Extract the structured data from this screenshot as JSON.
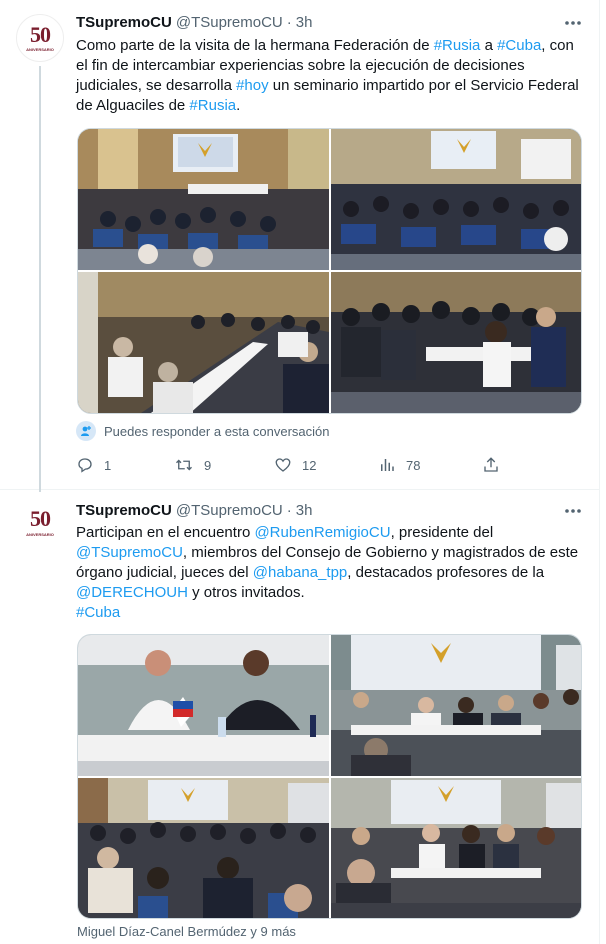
{
  "tweets": [
    {
      "name": "TSupremoCU",
      "handle": "@TSupremoCU",
      "separator": "·",
      "time": "3h",
      "avatar_number": "50",
      "avatar_caption": "ANIVERSARIO",
      "text_parts": {
        "p1": "Como parte de la visita de la hermana Federación de ",
        "l1": "#Rusia",
        "p2": " a ",
        "l2": "#Cuba",
        "p3": ", con el fin de intercambiar experiencias sobre la ejecución de decisiones judiciales, se desarrolla ",
        "l3": "#hoy",
        "p4": " un seminario impartido por el Servicio Federal de Alguaciles de ",
        "l4": "#Rusia",
        "p5": "."
      },
      "reply_notice": "Puedes responder a esta conversación",
      "counts": {
        "replies": "1",
        "retweets": "9",
        "likes": "12",
        "views": "78"
      }
    },
    {
      "name": "TSupremoCU",
      "handle": "@TSupremoCU",
      "separator": "·",
      "time": "3h",
      "avatar_number": "50",
      "avatar_caption": "ANIVERSARIO",
      "text_parts": {
        "p1": "Participan en el encuentro ",
        "l1": "@RubenRemigioCU",
        "p2": ", presidente del ",
        "l2": "@TSupremoCU",
        "p3": ", miembros del Consejo de Gobierno y magistrados de este órgano judicial, jueces del ",
        "l3": "@habana_tpp",
        "p4": ", destacados profesores de la ",
        "l4": "@DERECHOUH",
        "p5": " y otros invitados.",
        "l5": "#Cuba"
      },
      "tagged_credit": "Miguel Díaz-Canel Bermúdez y 9 más"
    }
  ],
  "colors": {
    "link": "#1d9bf0",
    "secondary": "#536471",
    "brand": "#7a1e2e"
  }
}
